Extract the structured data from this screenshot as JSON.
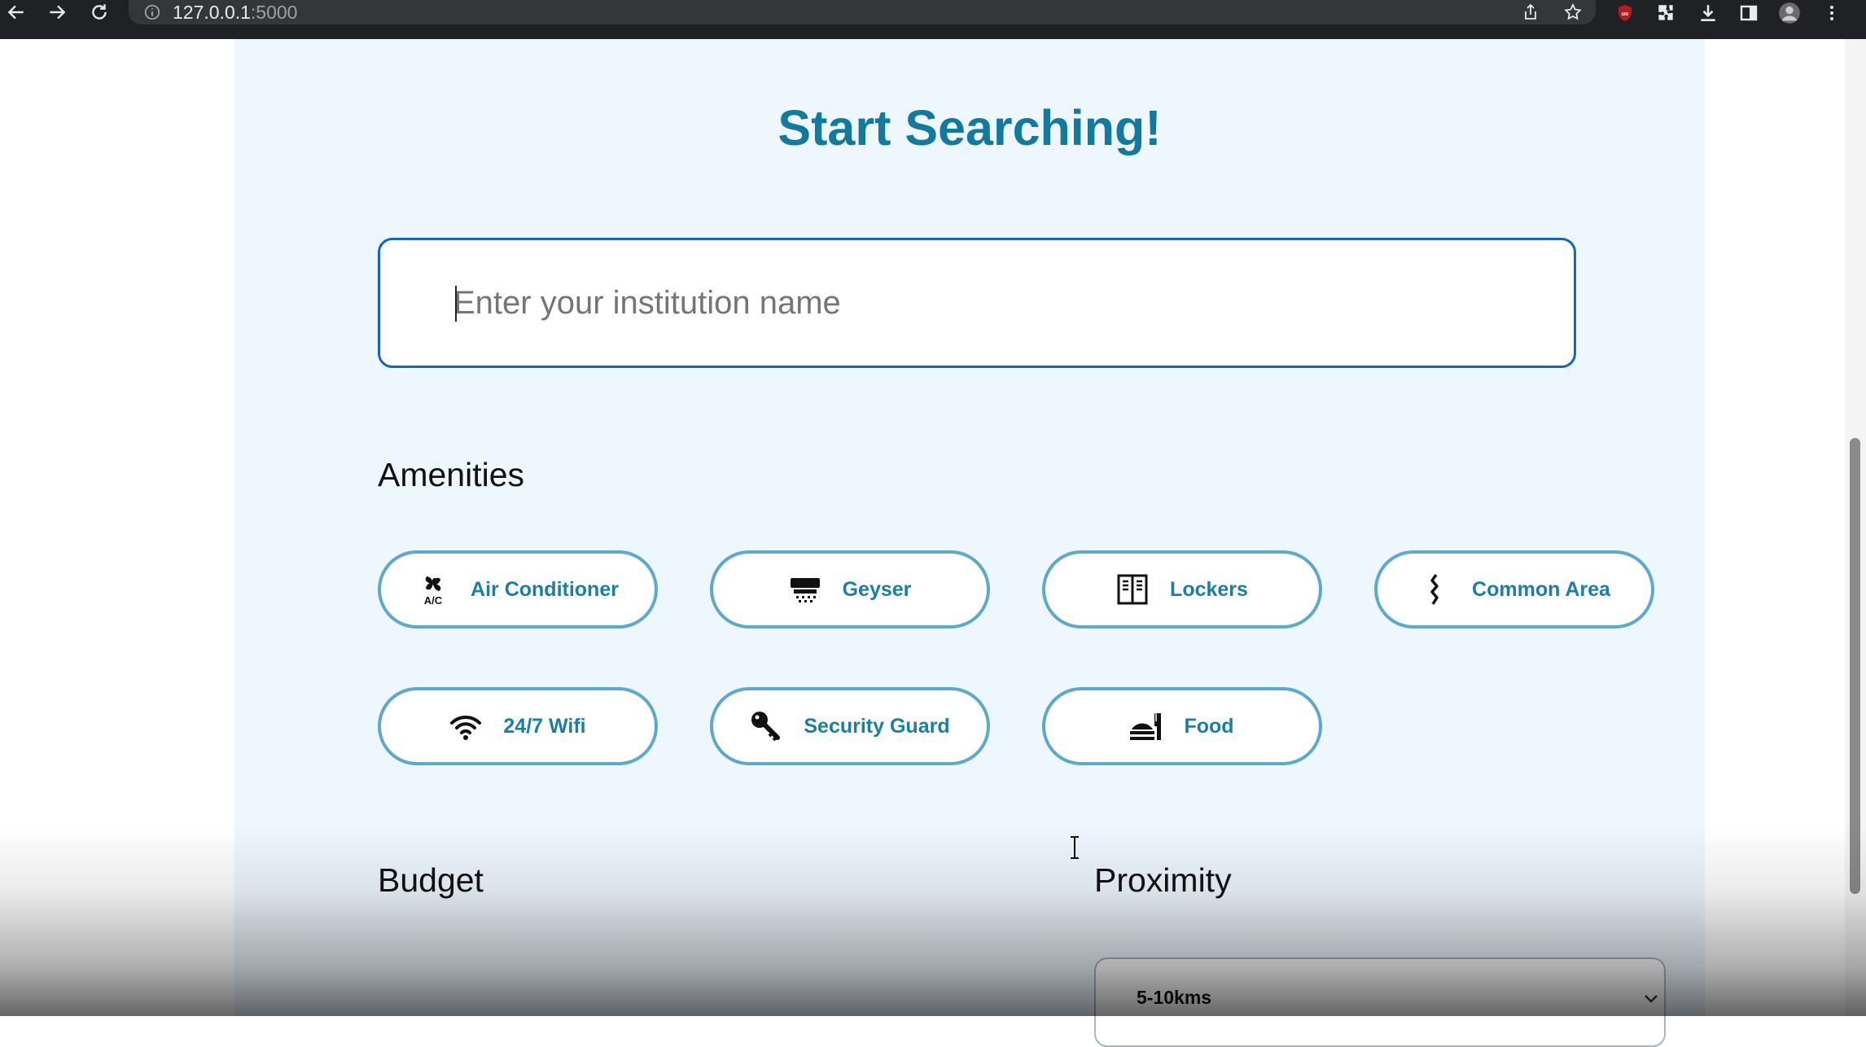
{
  "browser": {
    "url_host": "127.0.0.1",
    "url_port": ":5000"
  },
  "page": {
    "title": "Start Searching!",
    "search": {
      "placeholder": "Enter your institution name",
      "value": ""
    },
    "amenities": {
      "heading": "Amenities",
      "items": [
        {
          "label": "Air Conditioner",
          "icon": "air-conditioner-icon"
        },
        {
          "label": "Geyser",
          "icon": "geyser-icon"
        },
        {
          "label": "Lockers",
          "icon": "lockers-icon"
        },
        {
          "label": "Common Area",
          "icon": "common-area-icon"
        },
        {
          "label": "24/7 Wifi",
          "icon": "wifi-icon"
        },
        {
          "label": "Security Guard",
          "icon": "key-icon"
        },
        {
          "label": "Food",
          "icon": "food-icon"
        }
      ]
    },
    "budget": {
      "heading": "Budget"
    },
    "proximity": {
      "heading": "Proximity",
      "selected": "5-10kms"
    }
  },
  "colors": {
    "title": "#137a9e",
    "chip_border": "#5ea8cc",
    "chip_text": "#1b7fa5",
    "search_border": "#1565c0",
    "panel_bg": "#eef6fe"
  }
}
